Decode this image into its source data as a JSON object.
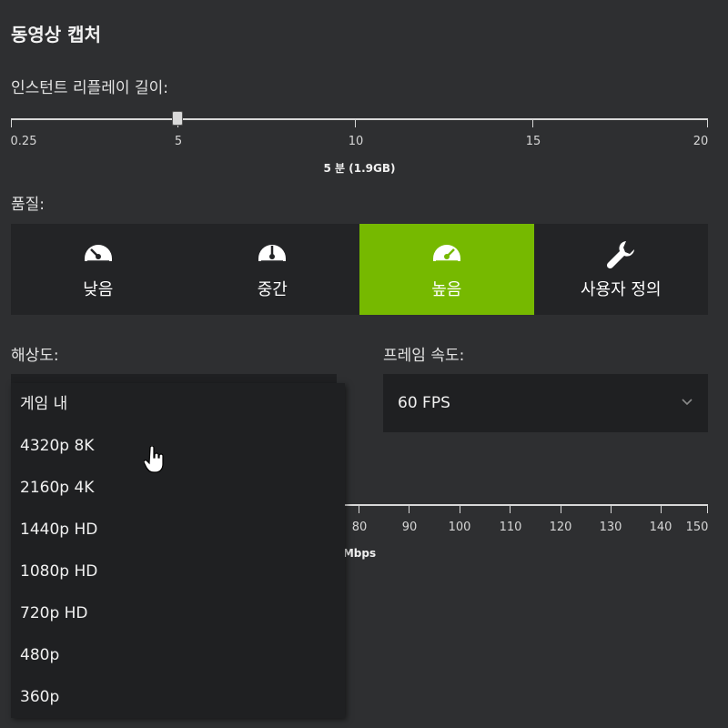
{
  "section": {
    "title": "동영상 캡처"
  },
  "instant_replay": {
    "label": "인스턴트 리플레이 길이:",
    "ticks": [
      "0.25",
      "5",
      "10",
      "15",
      "20"
    ],
    "value_text": "5 분 (1.9GB)",
    "value": 5
  },
  "quality": {
    "label": "품질:",
    "options": [
      {
        "label": "낮음",
        "icon": "gauge-low-icon"
      },
      {
        "label": "중간",
        "icon": "gauge-medium-icon"
      },
      {
        "label": "높음",
        "icon": "gauge-high-icon",
        "selected": true
      },
      {
        "label": "사용자 정의",
        "icon": "wrench-icon"
      }
    ],
    "accent": "#76b900"
  },
  "resolution": {
    "label": "해상도:",
    "menu_items": [
      "게임 내",
      "4320p 8K",
      "2160p 4K",
      "1440p HD",
      "1080p HD",
      "720p HD",
      "480p",
      "360p"
    ]
  },
  "frame_rate": {
    "label": "프레임 속도:",
    "value": "60 FPS"
  },
  "bitrate": {
    "ticks": [
      "80",
      "90",
      "100",
      "110",
      "120",
      "130",
      "140",
      "150"
    ],
    "unit": "Mbps"
  }
}
